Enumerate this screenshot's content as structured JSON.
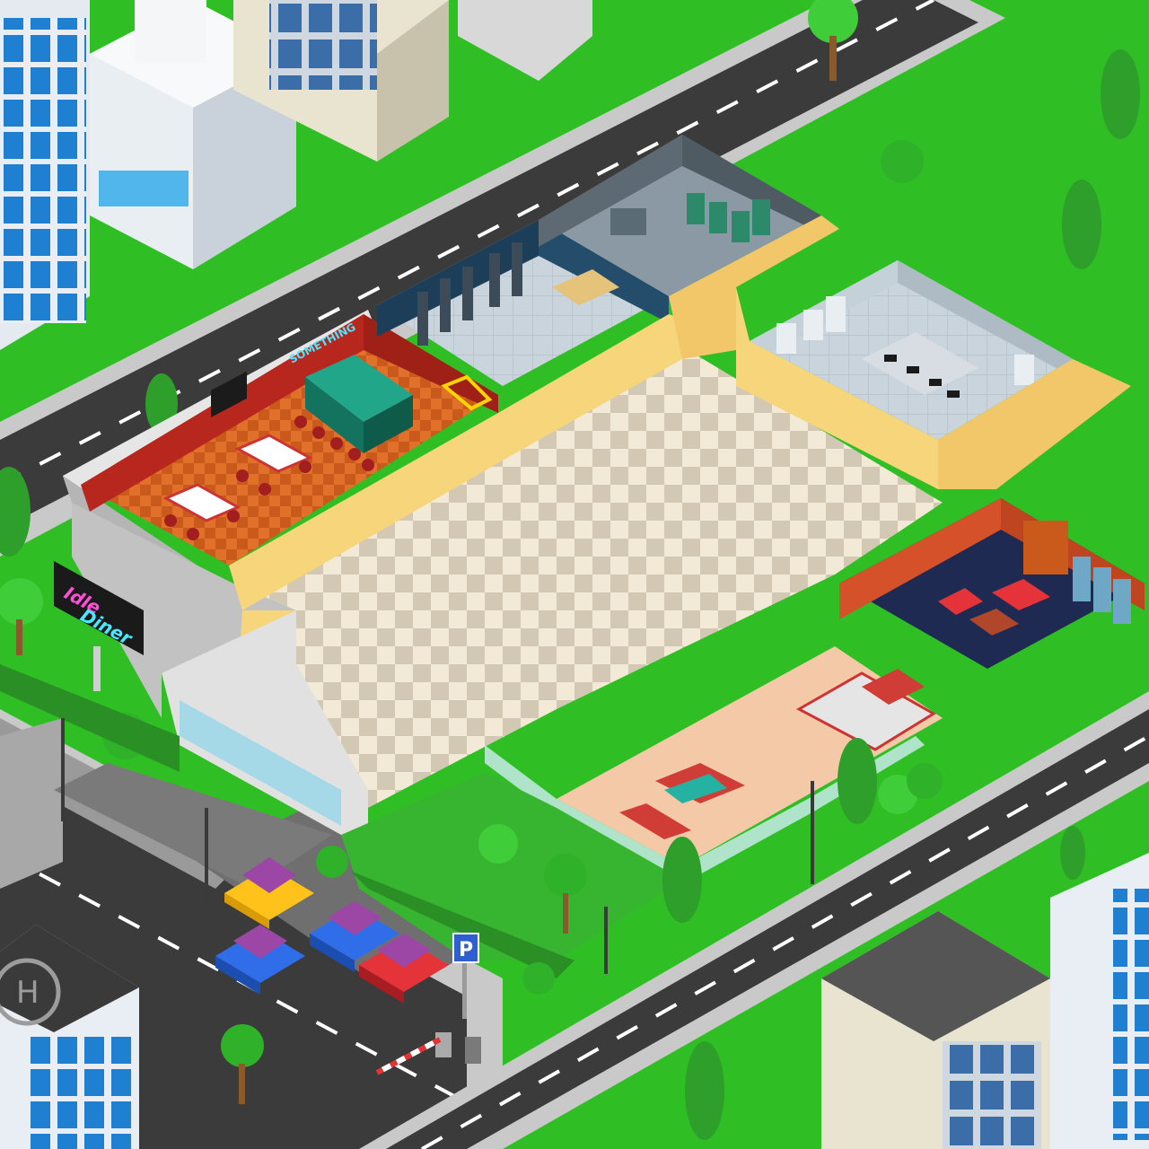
{
  "scene": {
    "neon_sign_line1": "Idle",
    "neon_sign_line2": "Diner",
    "restaurant_wall_sign": "SOMETHING",
    "parking_sign": "P",
    "helipad_letter": "H"
  },
  "colors": {
    "grass": "#2fbf24",
    "grass_dark": "#22a31b",
    "road": "#3b3b3b",
    "sidewalk": "#c9c9c9",
    "wall_yellow": "#f7d57a",
    "wall_red": "#b8271d",
    "floor_orange": "#e0702a",
    "checker_light": "#f2ead6",
    "checker_dark": "#d2c8b3",
    "neon_pink": "#ff4fd8",
    "neon_cyan": "#48e8ff"
  },
  "cars": [
    {
      "name": "yellow-car",
      "color": "#ffc21a"
    },
    {
      "name": "blue-car",
      "color": "#2f6ee8"
    },
    {
      "name": "blue-car",
      "color": "#2f6ee8"
    },
    {
      "name": "red-car",
      "color": "#e5333a"
    }
  ]
}
